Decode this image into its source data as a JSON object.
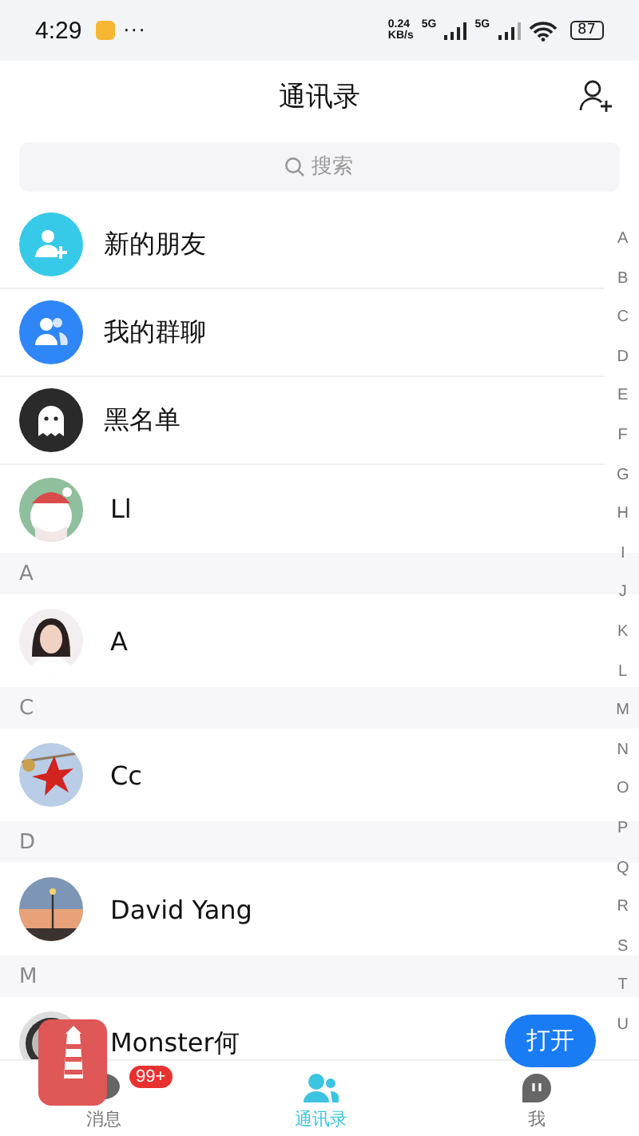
{
  "status_bar": {
    "time": "4:29",
    "more": "···",
    "speed_value": "0.24",
    "speed_unit": "KB/s",
    "network_1": "5G",
    "network_2": "5G",
    "battery": "87"
  },
  "header": {
    "title": "通讯录"
  },
  "search": {
    "placeholder": "搜索"
  },
  "shortcuts": [
    {
      "kind": "new-friends",
      "label": "新的朋友",
      "color": "#37c9e8"
    },
    {
      "kind": "groups",
      "label": "我的群聊",
      "color": "#2f86f6"
    },
    {
      "kind": "blacklist",
      "label": "黑名单",
      "color": "#2a2a2a"
    }
  ],
  "sections": [
    {
      "contacts": [
        {
          "name": "Ll"
        }
      ]
    },
    {
      "letter": "A",
      "contacts": [
        {
          "name": "A"
        }
      ]
    },
    {
      "letter": "C",
      "contacts": [
        {
          "name": "Cc"
        }
      ]
    },
    {
      "letter": "D",
      "contacts": [
        {
          "name": "David Yang"
        }
      ]
    },
    {
      "letter": "M",
      "contacts": [
        {
          "name": "Monster何"
        }
      ]
    }
  ],
  "index": [
    "A",
    "B",
    "C",
    "D",
    "E",
    "F",
    "G",
    "H",
    "I",
    "J",
    "K",
    "L",
    "M",
    "N",
    "O",
    "P",
    "Q",
    "R",
    "S",
    "T",
    "U"
  ],
  "tabs": [
    {
      "kind": "messages",
      "label": "消息",
      "selected": false
    },
    {
      "kind": "contacts",
      "label": "通讯录",
      "selected": true
    },
    {
      "kind": "me",
      "label": "我",
      "selected": false
    }
  ],
  "floating": {
    "badge": "99+",
    "button": "打开"
  }
}
